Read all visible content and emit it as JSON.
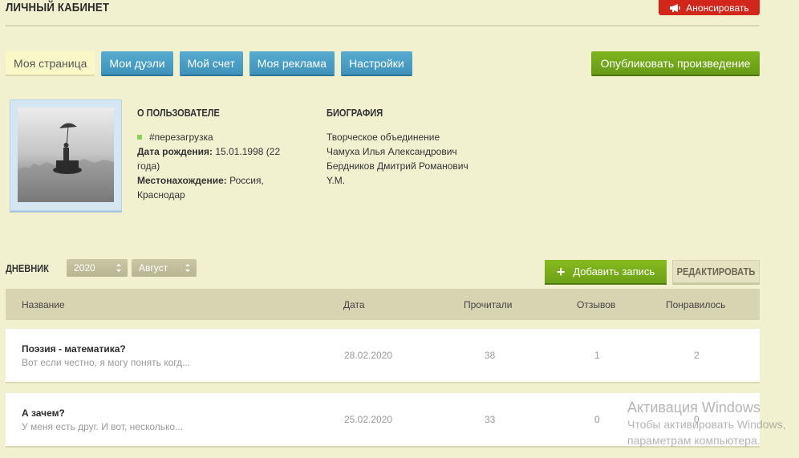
{
  "header": {
    "title": "ЛИЧНЫЙ КАБИНЕТ",
    "announce_label": "Анонсировать"
  },
  "tabs": [
    {
      "label": "Моя страница",
      "active": true
    },
    {
      "label": "Мои дуэли",
      "active": false
    },
    {
      "label": "Мой счет",
      "active": false
    },
    {
      "label": "Моя реклама",
      "active": false
    },
    {
      "label": "Настройки",
      "active": false
    }
  ],
  "publish_label": "Опубликовать произведение",
  "profile": {
    "about_heading": "О ПОЛЬЗОВАТЕЛЕ",
    "status": "#перезагрузка",
    "birth_label": "Дата рождения:",
    "birth_value": "15.01.1998 (22 года)",
    "location_label": "Местонахождение:",
    "location_value": "Россия, Краснодар",
    "bio_heading": "БИОГРАФИЯ",
    "bio_lines": [
      "Творческое объединение",
      "Чамуха Илья Александрович",
      "Бердников Дмитрий Романович",
      "Y.M."
    ]
  },
  "diary": {
    "label": "ДНЕВНИК",
    "year": "2020",
    "month": "Август",
    "add_label": "Добавить запись",
    "edit_label": "РЕДАКТИРОВАТЬ",
    "columns": {
      "name": "Название",
      "date": "Дата",
      "reads": "Прочитали",
      "reviews": "Отзывов",
      "likes": "Понравилось"
    },
    "rows": [
      {
        "title": "Поэзия - математика?",
        "excerpt": "Вот если честно, я могу понять когд...",
        "date": "28.02.2020",
        "reads": "38",
        "reviews": "1",
        "likes": "2"
      },
      {
        "title": "А зачем?",
        "excerpt": "У меня есть друг. И вот, несколько...",
        "date": "25.02.2020",
        "reads": "33",
        "reviews": "0",
        "likes": "0"
      }
    ]
  },
  "watermark": {
    "title": "Активация Windows",
    "line1": "Чтобы активировать Windows,",
    "line2": "параметрам компьютера."
  },
  "colors": {
    "background": "#f1f0cf",
    "tab_blue": "#4aa0c6",
    "active_tab": "#fbf8c7",
    "green": "#72a818",
    "announce_red": "#d3261b",
    "table_header": "#d7d5b1"
  },
  "icons": {
    "announce": "megaphone-icon",
    "add": "plus-icon",
    "select": "up-down-arrows-icon",
    "status": "online-dot-icon"
  }
}
